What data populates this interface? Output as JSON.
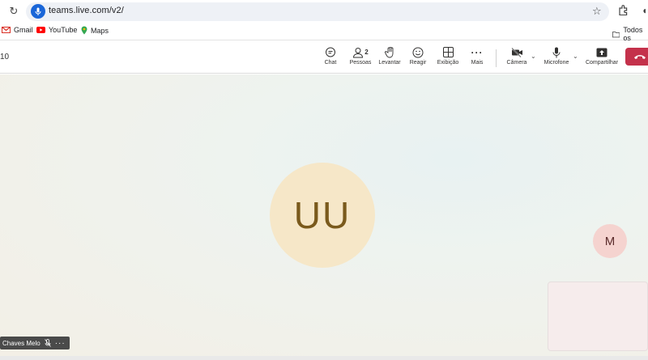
{
  "browser": {
    "url": "teams.live.com/v2/",
    "bookmarks": [
      {
        "label": "Gmail"
      },
      {
        "label": "YouTube"
      },
      {
        "label": "Maps"
      }
    ],
    "all_bookmarks_label": "Todos os"
  },
  "meeting": {
    "timer": "10",
    "toolbar": {
      "chat": "Chat",
      "people": "Pessoas",
      "people_count": "2",
      "raise": "Levantar",
      "react": "Reagir",
      "view": "Exibição",
      "more": "Mais",
      "camera": "Câmera",
      "mic": "Microfone",
      "share": "Compartilhar"
    },
    "main_participant": {
      "initials": "UU",
      "name_tag": "Chaves Melo"
    },
    "self_view": {
      "initial": "M"
    }
  }
}
